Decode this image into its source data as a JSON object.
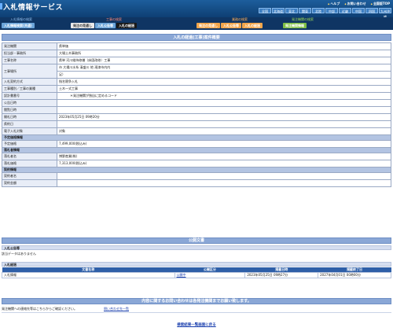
{
  "header": {
    "title": "入札情報サービス",
    "top_links": [
      "ヘルプ",
      "お問い合わせ",
      "全国版TOP"
    ],
    "regions": [
      "全国",
      "北海道",
      "東北",
      "関東",
      "北陸",
      "中部",
      "近畿",
      "中国",
      "四国",
      "九州沖縄"
    ]
  },
  "nav": {
    "g1_title": "入札情報の検索",
    "g1_buttons": [
      "入札情報検索(共通)"
    ],
    "g2_title": "工事の検索",
    "g2_buttons": [
      "発注の見通し",
      "入札公告等",
      "入札の経過"
    ],
    "g3_title": "業務の検索",
    "g3_buttons": [
      "発注の見通し",
      "入札公告等",
      "入札の経過"
    ],
    "g4_title": "発注機関の検索",
    "g4_buttons": [
      "発注機関情報"
    ]
  },
  "main": {
    "section_title": "入札の経過(工事)案件概要",
    "rows": [
      {
        "k": "発注機関",
        "v": "県単価"
      },
      {
        "k": "担当部・事務所",
        "v": "大場土木事務所"
      },
      {
        "k": "工事名称",
        "v": "県単 河川維持修繕（床固改修）工事"
      },
      {
        "k": "工事場所",
        "v": "市  大場川水系 清盛川  地  滝津市内内"
      },
      {
        "k": "",
        "v": "足）"
      },
      {
        "k": "入札契約方式",
        "v": "指名競争入札"
      },
      {
        "k": "工事種別／工事の業種",
        "v": "土木一式工事"
      },
      {
        "k": "設計書番号",
        "v": "＊発注機関が独自に定めるコード"
      },
      {
        "k": "公告日時",
        "v": ""
      },
      {
        "k": "閲覧日時",
        "v": ""
      },
      {
        "k": "開札日時",
        "v": "2023年05月25日 09時20分"
      },
      {
        "k": "県約日",
        "v": ""
      },
      {
        "k": "電子入札対象",
        "v": "対象"
      }
    ],
    "yotei_title": "予定価格情報",
    "yotei_rows": [
      {
        "k": "予定価格",
        "v": "7,499,000(税込み)"
      }
    ],
    "rakusatsu_title": "落札者情報",
    "rakusatsu_rows": [
      {
        "k": "落札者名",
        "v": "博野産業(株)"
      },
      {
        "k": "落札価格",
        "v": "7,313,000(税込み)"
      }
    ],
    "keiyaku_title": "契約情報",
    "keiyaku_rows": [
      {
        "k": "契約者名",
        "v": ""
      },
      {
        "k": "契約金額",
        "v": ""
      }
    ]
  },
  "kokai": {
    "section_title": "公開文書",
    "nyusatsu_kokoku_title": "入札公告等",
    "nyusatsu_kokoku_note": "該当データはありません",
    "keika_title": "入札経過",
    "cols": [
      "文書名称",
      "公開区分",
      "掲載日時",
      "掲載終了日"
    ],
    "rows": [
      [
        "入札情報",
        "公開中",
        "2023年05月25日 09時27分",
        "2027年04月01日 00時00分"
      ]
    ]
  },
  "contact": {
    "title": "内容に関するお問い合わせは各発注機関までお願い致します。",
    "left_text": "発注機関への連絡先等はこちらからご確認ください。",
    "link_text": "問い合わせ先一覧"
  },
  "footer": {
    "back_link": "検索結果一覧画面に戻る"
  }
}
